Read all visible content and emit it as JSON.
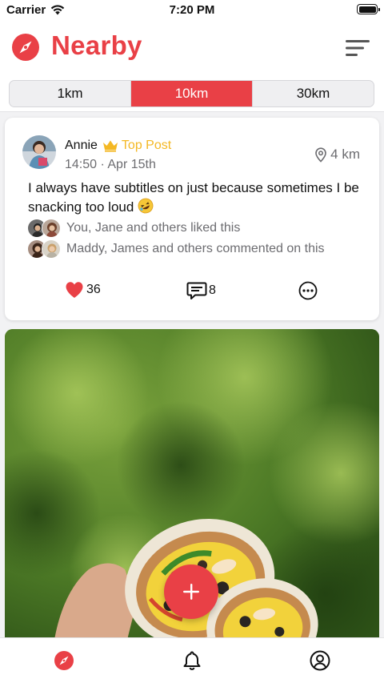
{
  "status_bar": {
    "carrier": "Carrier",
    "time": "7:20 PM"
  },
  "header": {
    "title": "Nearby",
    "logo_icon": "compass-icon",
    "menu_icon": "sort-menu-icon"
  },
  "distance_filter": {
    "options": [
      "1km",
      "10km",
      "30km"
    ],
    "selected": "10km"
  },
  "post": {
    "author": "Annie",
    "badge": "Top Post",
    "timestamp": "14:50 · Apr 15th",
    "distance": "4 km",
    "text": "I always have subtitles on just because sometimes I be snacking too loud",
    "emoji": "rolling-on-floor-laughing-emoji",
    "likes_summary": "You, Jane and others liked this",
    "comments_summary": "Maddy, James and others commented on this",
    "like_count": "36",
    "comment_count": "8"
  },
  "tab_bar": {
    "items": [
      "nearby",
      "notifications",
      "profile"
    ],
    "active": "nearby"
  },
  "colors": {
    "accent": "#e94046",
    "badge": "#f4b824",
    "secondary_text": "#6c6c70"
  }
}
